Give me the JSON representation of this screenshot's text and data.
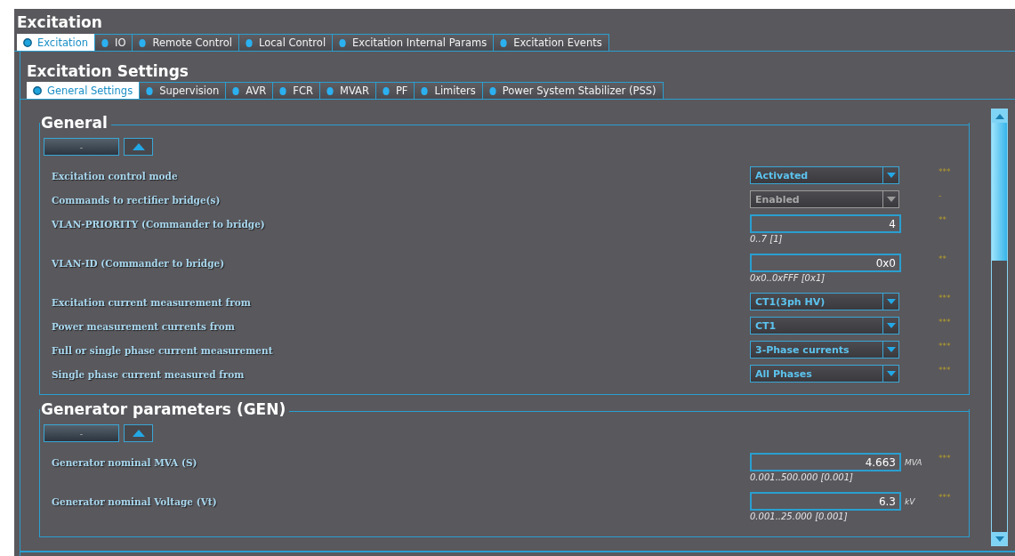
{
  "window": {
    "title": "Excitation"
  },
  "tabs": [
    {
      "label": "Excitation",
      "selected": true
    },
    {
      "label": "IO",
      "selected": false
    },
    {
      "label": "Remote Control",
      "selected": false
    },
    {
      "label": "Local Control",
      "selected": false
    },
    {
      "label": "Excitation Internal Params",
      "selected": false
    },
    {
      "label": "Excitation  Events",
      "selected": false
    }
  ],
  "panel": {
    "title": "Excitation Settings"
  },
  "subtabs": [
    {
      "label": "General Settings",
      "selected": true
    },
    {
      "label": "Supervision",
      "selected": false
    },
    {
      "label": "AVR",
      "selected": false
    },
    {
      "label": "FCR",
      "selected": false
    },
    {
      "label": "MVAR",
      "selected": false
    },
    {
      "label": "PF",
      "selected": false
    },
    {
      "label": "Limiters",
      "selected": false
    },
    {
      "label": "Power System Stabilizer (PSS)",
      "selected": false
    }
  ],
  "sections": [
    {
      "title": "General",
      "collapse_button": "-",
      "rows": [
        {
          "kind": "select",
          "label": "Excitation control mode",
          "value": "Activated",
          "disabled": false,
          "access": "***"
        },
        {
          "kind": "select",
          "label": "Commands to rectifier bridge(s)",
          "value": "Enabled",
          "disabled": true,
          "access": "-"
        },
        {
          "kind": "number",
          "label": "VLAN-PRIORITY (Commander to bridge)",
          "value": "4",
          "range": "0..7 [1]",
          "access": "**"
        },
        {
          "kind": "number",
          "label": "VLAN-ID (Commander to bridge)",
          "value": "0x0",
          "range": "0x0..0xFFF [0x1]",
          "access": "**"
        },
        {
          "kind": "select",
          "label": "Excitation current measurement from",
          "value": "CT1(3ph HV)",
          "disabled": false,
          "access": "***"
        },
        {
          "kind": "select",
          "label": "Power measurement currents from",
          "value": "CT1",
          "disabled": false,
          "access": "***"
        },
        {
          "kind": "select",
          "label": "Full or single phase current measurement",
          "value": "3-Phase currents",
          "disabled": false,
          "access": "***"
        },
        {
          "kind": "select",
          "label": "Single phase current measured from",
          "value": "All Phases",
          "disabled": false,
          "access": "***"
        }
      ]
    },
    {
      "title": "Generator parameters (GEN)",
      "collapse_button": "-",
      "rows": [
        {
          "kind": "number",
          "label": "Generator nominal MVA (S)",
          "value": "4.663",
          "unit": "MVA",
          "range": "0.001..500.000 [0.001]",
          "access": "***"
        },
        {
          "kind": "number",
          "label": "Generator nominal Voltage (Vt)",
          "value": "6.3",
          "unit": "kV",
          "range": "0.001..25.000 [0.001]",
          "access": "***"
        }
      ]
    }
  ]
}
